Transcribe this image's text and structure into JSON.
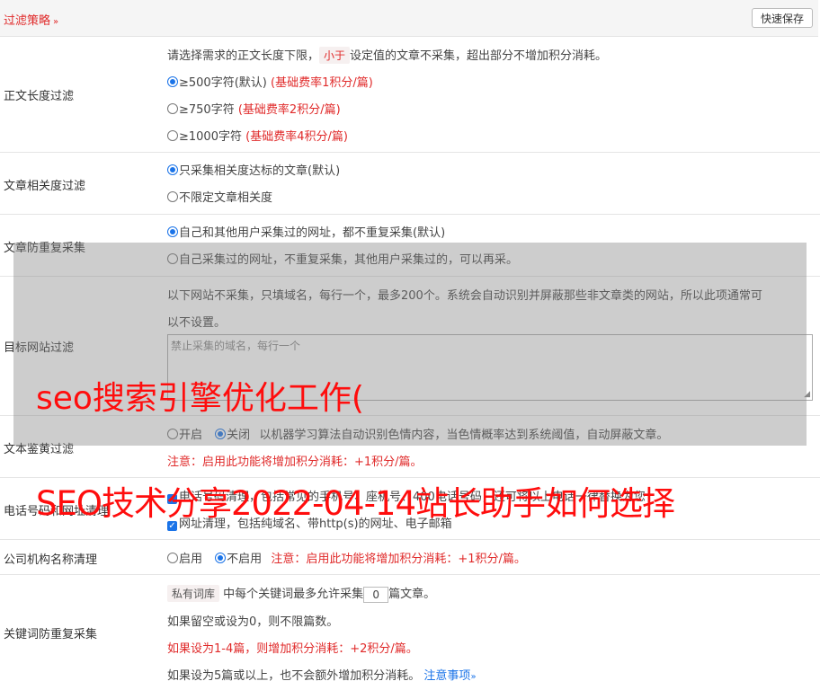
{
  "header": {
    "title": "过滤策略",
    "chevron": "»",
    "save_label": "快速保存"
  },
  "length_filter": {
    "label": "正文长度过滤",
    "desc_before": "请选择需求的正文长度下限，",
    "desc_tag": "小于",
    "desc_after": "设定值的文章不采集，超出部分不增加积分消耗。",
    "options": [
      {
        "text": "≥500字符(默认)",
        "note": "(基础费率1积分/篇)",
        "selected": true
      },
      {
        "text": "≥750字符",
        "note": "(基础费率2积分/篇)",
        "selected": false
      },
      {
        "text": "≥1000字符",
        "note": "(基础费率4积分/篇)",
        "selected": false
      }
    ]
  },
  "relevance_filter": {
    "label": "文章相关度过滤",
    "options": [
      {
        "text": "只采集相关度达标的文章(默认)",
        "selected": true
      },
      {
        "text": "不限定文章相关度",
        "selected": false
      }
    ]
  },
  "dedup_filter": {
    "label": "文章防重复采集",
    "options": [
      {
        "text": "自己和其他用户采集过的网址，都不重复采集(默认)",
        "selected": true
      },
      {
        "text": "自己采集过的网址，不重复采集，其他用户采集过的，可以再采。",
        "selected": false
      }
    ]
  },
  "site_filter": {
    "label": "目标网站过滤",
    "desc_line1": "以下网站不采集，只填域名，每行一个，最多200个。系统会自动识别并屏蔽那些非文章类的网站，所以此项通常可",
    "desc_line2": "以不设置。",
    "placeholder": "禁止采集的域名，每行一个"
  },
  "porn_filter": {
    "label": "文本鉴黄过滤",
    "on_label": "开启",
    "off_label": "关闭",
    "desc": "以机器学习算法自动识别色情内容，当色情概率达到系统阈值，自动屏蔽文章。",
    "note": "注意：启用此功能将增加积分消耗：+1积分/篇。"
  },
  "phone_clean": {
    "label": "电话号码和网址清理",
    "line1": "电话号码清理，包括常见的手机号、座机号、400电话号码，还可将以上电话一律替换为您",
    "line2": "网址清理，包括纯域名、带http(s)的网址、电子邮箱"
  },
  "org_clean": {
    "label": "公司机构名称清理",
    "enable_label": "启用",
    "disable_label": "不启用",
    "note": "注意：启用此功能将增加积分消耗：+1积分/篇。"
  },
  "keyword_dedup": {
    "label": "关键词防重复采集",
    "tag": "私有词库",
    "line1_before": "中每个关键词最多允许采集",
    "value": "0",
    "line1_after": "篇文章。",
    "line2": "如果留空或设为0，则不限篇数。",
    "line3": "如果设为1-4篇，则增加积分消耗：+2积分/篇。",
    "line4": "如果设为5篇或以上，也不会额外增加积分消耗。",
    "notes_link": "注意事项",
    "notes_chevron": "»"
  },
  "watermark": {
    "line1": "seo搜索引擎优化工作(",
    "line2": "SEO技术分享2022-04-14站长助手如何选择"
  }
}
